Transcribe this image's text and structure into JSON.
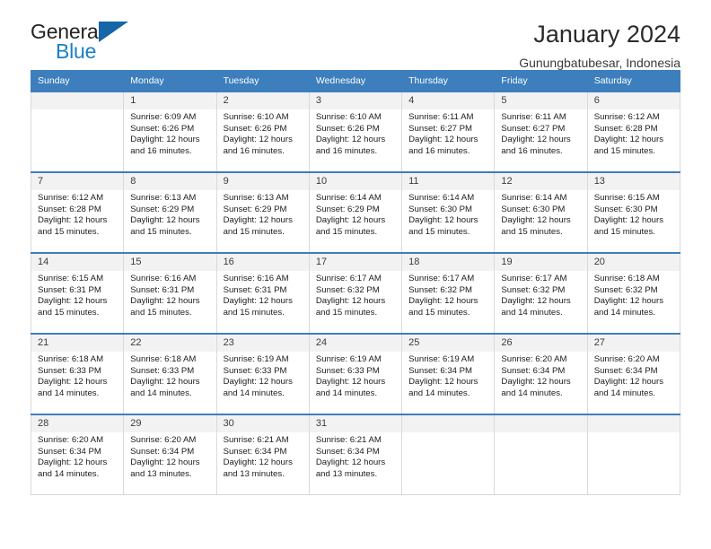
{
  "brand": {
    "word_one": "General",
    "word_two": "Blue",
    "accent_color": "#1a7fc4",
    "triangle_color": "#1565a8",
    "triangle_icon": "triangle-right-icon"
  },
  "header": {
    "title": "January 2024",
    "subtitle": "Gunungbatubesar, Indonesia",
    "header_bg_color": "#3d7ebd",
    "header_text_color": "#ffffff"
  },
  "calendar": {
    "weekday_headers": [
      "Sunday",
      "Monday",
      "Tuesday",
      "Wednesday",
      "Thursday",
      "Friday",
      "Saturday"
    ],
    "weeks": [
      [
        {
          "day": "",
          "lines": []
        },
        {
          "day": "1",
          "lines": [
            "Sunrise: 6:09 AM",
            "Sunset: 6:26 PM",
            "Daylight: 12 hours and 16 minutes."
          ]
        },
        {
          "day": "2",
          "lines": [
            "Sunrise: 6:10 AM",
            "Sunset: 6:26 PM",
            "Daylight: 12 hours and 16 minutes."
          ]
        },
        {
          "day": "3",
          "lines": [
            "Sunrise: 6:10 AM",
            "Sunset: 6:26 PM",
            "Daylight: 12 hours and 16 minutes."
          ]
        },
        {
          "day": "4",
          "lines": [
            "Sunrise: 6:11 AM",
            "Sunset: 6:27 PM",
            "Daylight: 12 hours and 16 minutes."
          ]
        },
        {
          "day": "5",
          "lines": [
            "Sunrise: 6:11 AM",
            "Sunset: 6:27 PM",
            "Daylight: 12 hours and 16 minutes."
          ]
        },
        {
          "day": "6",
          "lines": [
            "Sunrise: 6:12 AM",
            "Sunset: 6:28 PM",
            "Daylight: 12 hours and 15 minutes."
          ]
        }
      ],
      [
        {
          "day": "7",
          "lines": [
            "Sunrise: 6:12 AM",
            "Sunset: 6:28 PM",
            "Daylight: 12 hours and 15 minutes."
          ]
        },
        {
          "day": "8",
          "lines": [
            "Sunrise: 6:13 AM",
            "Sunset: 6:29 PM",
            "Daylight: 12 hours and 15 minutes."
          ]
        },
        {
          "day": "9",
          "lines": [
            "Sunrise: 6:13 AM",
            "Sunset: 6:29 PM",
            "Daylight: 12 hours and 15 minutes."
          ]
        },
        {
          "day": "10",
          "lines": [
            "Sunrise: 6:14 AM",
            "Sunset: 6:29 PM",
            "Daylight: 12 hours and 15 minutes."
          ]
        },
        {
          "day": "11",
          "lines": [
            "Sunrise: 6:14 AM",
            "Sunset: 6:30 PM",
            "Daylight: 12 hours and 15 minutes."
          ]
        },
        {
          "day": "12",
          "lines": [
            "Sunrise: 6:14 AM",
            "Sunset: 6:30 PM",
            "Daylight: 12 hours and 15 minutes."
          ]
        },
        {
          "day": "13",
          "lines": [
            "Sunrise: 6:15 AM",
            "Sunset: 6:30 PM",
            "Daylight: 12 hours and 15 minutes."
          ]
        }
      ],
      [
        {
          "day": "14",
          "lines": [
            "Sunrise: 6:15 AM",
            "Sunset: 6:31 PM",
            "Daylight: 12 hours and 15 minutes."
          ]
        },
        {
          "day": "15",
          "lines": [
            "Sunrise: 6:16 AM",
            "Sunset: 6:31 PM",
            "Daylight: 12 hours and 15 minutes."
          ]
        },
        {
          "day": "16",
          "lines": [
            "Sunrise: 6:16 AM",
            "Sunset: 6:31 PM",
            "Daylight: 12 hours and 15 minutes."
          ]
        },
        {
          "day": "17",
          "lines": [
            "Sunrise: 6:17 AM",
            "Sunset: 6:32 PM",
            "Daylight: 12 hours and 15 minutes."
          ]
        },
        {
          "day": "18",
          "lines": [
            "Sunrise: 6:17 AM",
            "Sunset: 6:32 PM",
            "Daylight: 12 hours and 15 minutes."
          ]
        },
        {
          "day": "19",
          "lines": [
            "Sunrise: 6:17 AM",
            "Sunset: 6:32 PM",
            "Daylight: 12 hours and 14 minutes."
          ]
        },
        {
          "day": "20",
          "lines": [
            "Sunrise: 6:18 AM",
            "Sunset: 6:32 PM",
            "Daylight: 12 hours and 14 minutes."
          ]
        }
      ],
      [
        {
          "day": "21",
          "lines": [
            "Sunrise: 6:18 AM",
            "Sunset: 6:33 PM",
            "Daylight: 12 hours and 14 minutes."
          ]
        },
        {
          "day": "22",
          "lines": [
            "Sunrise: 6:18 AM",
            "Sunset: 6:33 PM",
            "Daylight: 12 hours and 14 minutes."
          ]
        },
        {
          "day": "23",
          "lines": [
            "Sunrise: 6:19 AM",
            "Sunset: 6:33 PM",
            "Daylight: 12 hours and 14 minutes."
          ]
        },
        {
          "day": "24",
          "lines": [
            "Sunrise: 6:19 AM",
            "Sunset: 6:33 PM",
            "Daylight: 12 hours and 14 minutes."
          ]
        },
        {
          "day": "25",
          "lines": [
            "Sunrise: 6:19 AM",
            "Sunset: 6:34 PM",
            "Daylight: 12 hours and 14 minutes."
          ]
        },
        {
          "day": "26",
          "lines": [
            "Sunrise: 6:20 AM",
            "Sunset: 6:34 PM",
            "Daylight: 12 hours and 14 minutes."
          ]
        },
        {
          "day": "27",
          "lines": [
            "Sunrise: 6:20 AM",
            "Sunset: 6:34 PM",
            "Daylight: 12 hours and 14 minutes."
          ]
        }
      ],
      [
        {
          "day": "28",
          "lines": [
            "Sunrise: 6:20 AM",
            "Sunset: 6:34 PM",
            "Daylight: 12 hours and 14 minutes."
          ]
        },
        {
          "day": "29",
          "lines": [
            "Sunrise: 6:20 AM",
            "Sunset: 6:34 PM",
            "Daylight: 12 hours and 13 minutes."
          ]
        },
        {
          "day": "30",
          "lines": [
            "Sunrise: 6:21 AM",
            "Sunset: 6:34 PM",
            "Daylight: 12 hours and 13 minutes."
          ]
        },
        {
          "day": "31",
          "lines": [
            "Sunrise: 6:21 AM",
            "Sunset: 6:34 PM",
            "Daylight: 12 hours and 13 minutes."
          ]
        },
        {
          "day": "",
          "lines": []
        },
        {
          "day": "",
          "lines": []
        },
        {
          "day": "",
          "lines": []
        }
      ]
    ]
  }
}
